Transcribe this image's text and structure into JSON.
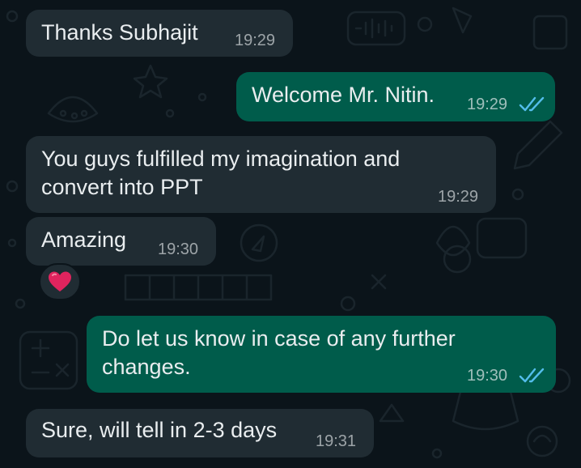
{
  "colors": {
    "background": "#0b141a",
    "incoming_bubble": "#202c33",
    "outgoing_bubble": "#005c4b",
    "read_ticks": "#53bdeb",
    "reaction_heart": "#e0245e"
  },
  "messages": [
    {
      "direction": "incoming",
      "text": "Thanks Subhajit",
      "time": "19:29"
    },
    {
      "direction": "outgoing",
      "text": "Welcome Mr. Nitin.",
      "time": "19:29",
      "status_icon": "double-check-read-icon"
    },
    {
      "direction": "incoming",
      "lines": [
        "You guys fulfilled my imagination and",
        "convert into PPT"
      ],
      "time": "19:29"
    },
    {
      "direction": "incoming",
      "text": "Amazing",
      "time": "19:30",
      "reaction_icon": "red-heart-icon"
    },
    {
      "direction": "outgoing",
      "lines": [
        "Do let us know in case of any further",
        "changes."
      ],
      "time": "19:30",
      "status_icon": "double-check-read-icon"
    },
    {
      "direction": "incoming",
      "text": "Sure, will tell in 2-3 days",
      "time": "19:31"
    }
  ]
}
